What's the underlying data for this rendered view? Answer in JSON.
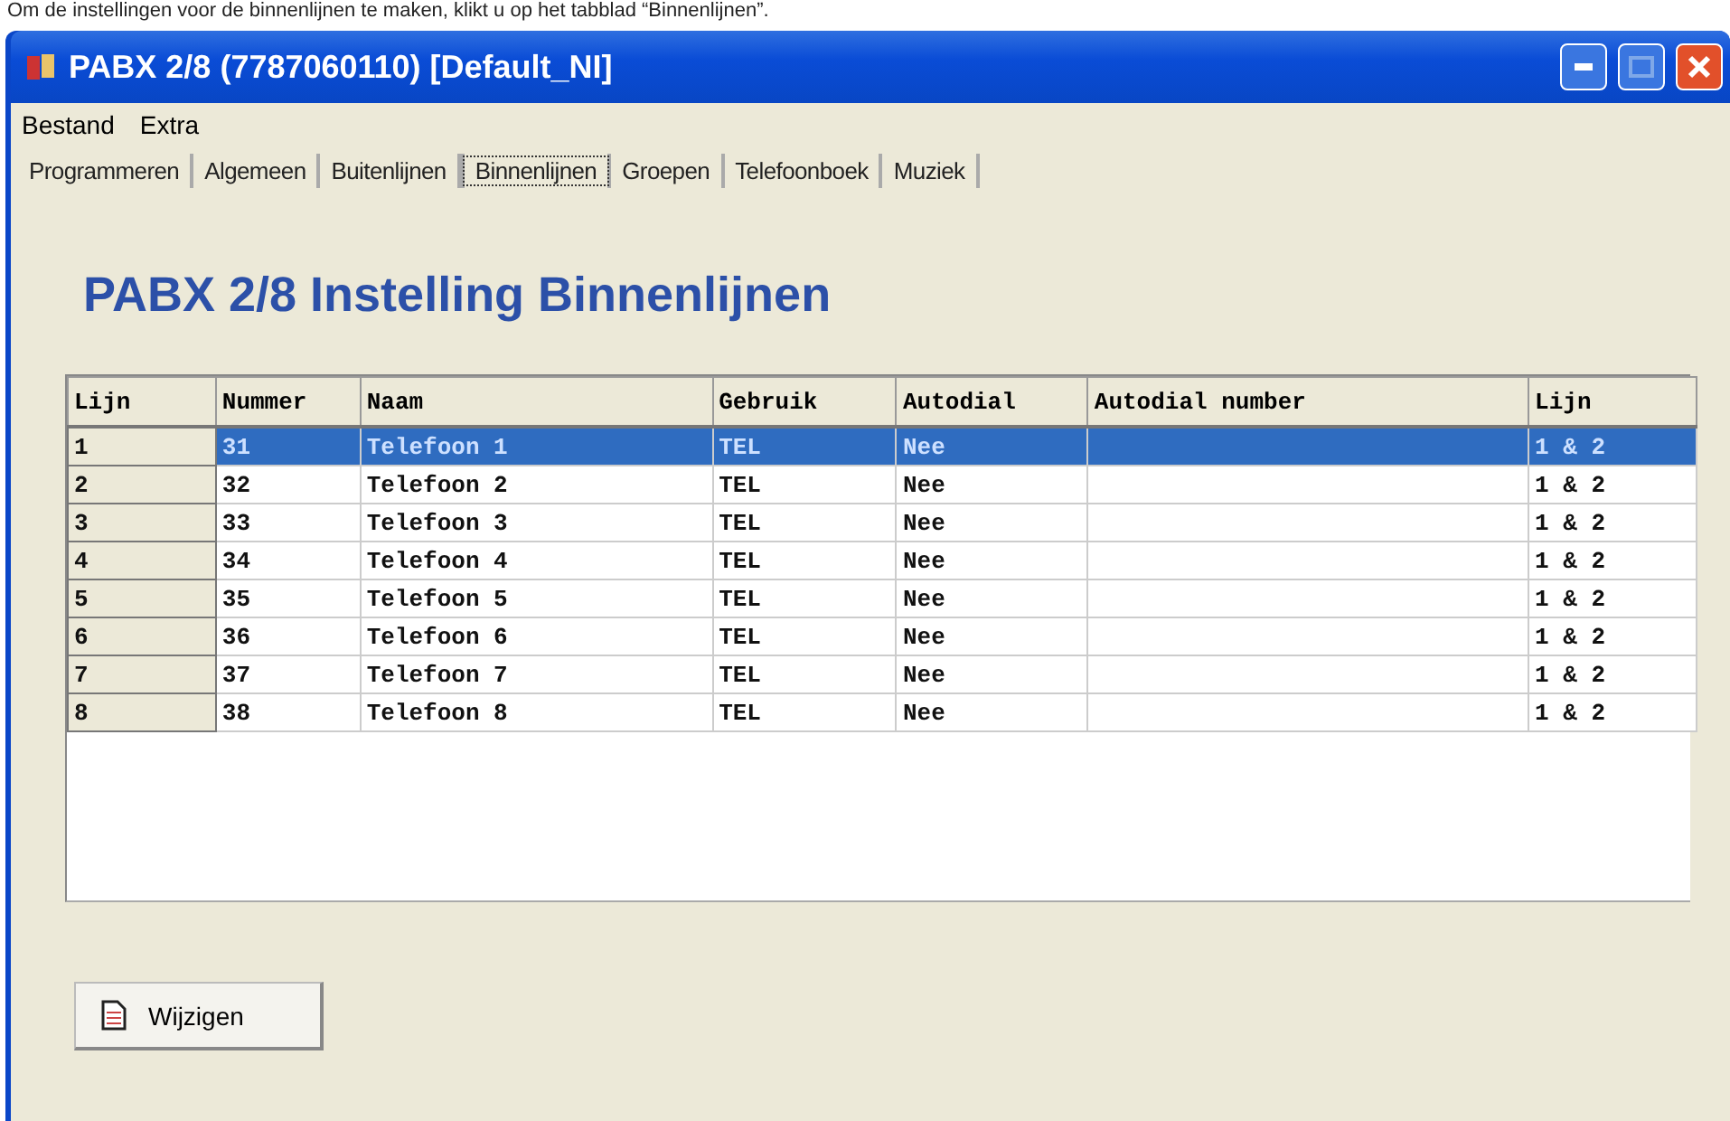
{
  "caption": "Om de instellingen voor de binnenlijnen te maken, klikt u op het tabblad “Binnenlijnen”.",
  "window": {
    "title": "PABX 2/8 (7787060110) [Default_NI]"
  },
  "menu": [
    "Bestand",
    "Extra"
  ],
  "tabs": [
    {
      "label": "Programmeren",
      "selected": false
    },
    {
      "label": "Algemeen",
      "selected": false
    },
    {
      "label": "Buitenlijnen",
      "selected": false
    },
    {
      "label": "Binnenlijnen",
      "selected": true
    },
    {
      "label": "Groepen",
      "selected": false
    },
    {
      "label": "Telefoonboek",
      "selected": false
    },
    {
      "label": "Muziek",
      "selected": false
    }
  ],
  "heading": "PABX 2/8 Instelling Binnenlijnen",
  "table": {
    "columns": [
      "Lijn",
      "Nummer",
      "Naam",
      "Gebruik",
      "Autodial",
      "Autodial number",
      "Lijn"
    ],
    "rows": [
      {
        "selected": true,
        "cells": [
          "1",
          "31",
          "Telefoon 1",
          "TEL",
          "Nee",
          "",
          "1 & 2"
        ]
      },
      {
        "selected": false,
        "cells": [
          "2",
          "32",
          "Telefoon 2",
          "TEL",
          "Nee",
          "",
          "1 & 2"
        ]
      },
      {
        "selected": false,
        "cells": [
          "3",
          "33",
          "Telefoon 3",
          "TEL",
          "Nee",
          "",
          "1 & 2"
        ]
      },
      {
        "selected": false,
        "cells": [
          "4",
          "34",
          "Telefoon 4",
          "TEL",
          "Nee",
          "",
          "1 & 2"
        ]
      },
      {
        "selected": false,
        "cells": [
          "5",
          "35",
          "Telefoon 5",
          "TEL",
          "Nee",
          "",
          "1 & 2"
        ]
      },
      {
        "selected": false,
        "cells": [
          "6",
          "36",
          "Telefoon 6",
          "TEL",
          "Nee",
          "",
          "1 & 2"
        ]
      },
      {
        "selected": false,
        "cells": [
          "7",
          "37",
          "Telefoon 7",
          "TEL",
          "Nee",
          "",
          "1 & 2"
        ]
      },
      {
        "selected": false,
        "cells": [
          "8",
          "38",
          "Telefoon 8",
          "TEL",
          "Nee",
          "",
          "1 & 2"
        ]
      }
    ]
  },
  "button": "Wijzigen"
}
